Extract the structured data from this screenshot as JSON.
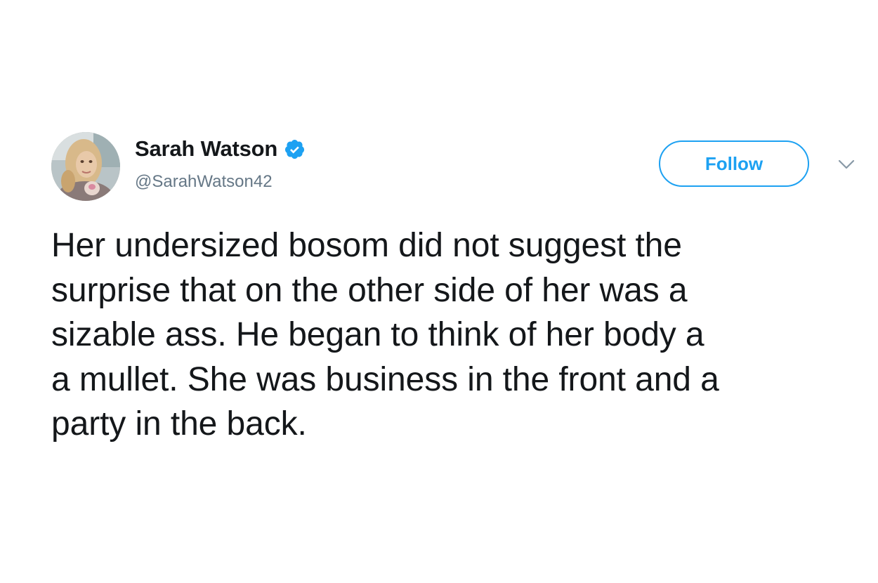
{
  "tweet": {
    "author": {
      "display_name": "Sarah Watson",
      "handle": "@SarahWatson42",
      "verified": true,
      "avatar_icon": "profile-photo"
    },
    "follow_label": "Follow",
    "menu_icon": "chevron-down-icon",
    "text": "Her undersized bosom did not suggest the\nsurprise that on the other side of her was a\nsizable ass. He began to think of her body a\na mullet. She was business in the front and a\nparty in the back."
  },
  "colors": {
    "accent": "#1da1f2",
    "text": "#14171a",
    "secondary_text": "#657786"
  }
}
